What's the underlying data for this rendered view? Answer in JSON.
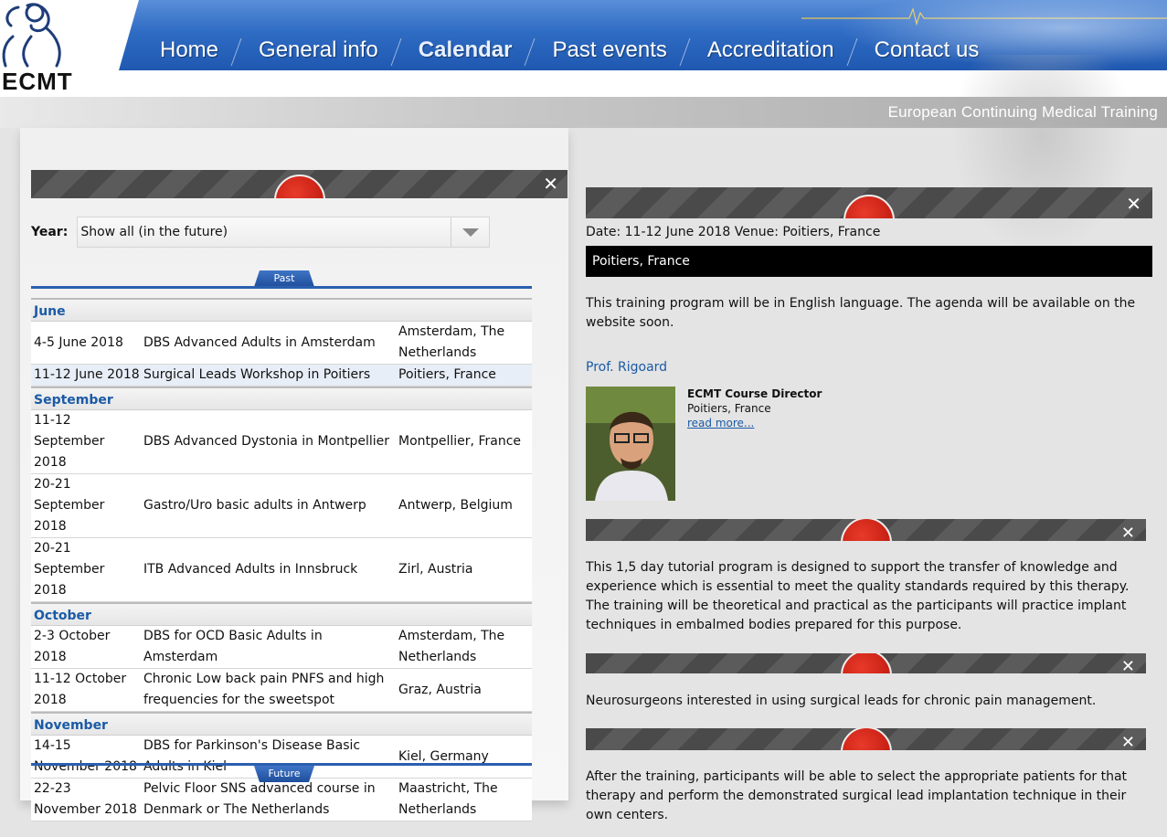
{
  "logo": {
    "text": "ECMT"
  },
  "nav": {
    "items": [
      {
        "label": "Home"
      },
      {
        "label": "General info"
      },
      {
        "label": "Calendar"
      },
      {
        "label": "Past events"
      },
      {
        "label": "Accreditation"
      },
      {
        "label": "Contact us"
      }
    ],
    "active": "Calendar"
  },
  "tagline": "European Continuing Medical Training",
  "filter": {
    "year_label": "Year:",
    "year_value": "Show all (in the future)"
  },
  "pager": {
    "past_label": "Past",
    "future_label": "Future"
  },
  "calendar": {
    "months": [
      {
        "name": "June",
        "events": [
          {
            "date": "4-5 June 2018",
            "title": "DBS Advanced Adults in Amsterdam",
            "location": "Amsterdam, The Netherlands"
          },
          {
            "date": "11-12 June 2018",
            "title": "Surgical Leads Workshop in Poitiers",
            "location": "Poitiers, France"
          }
        ]
      },
      {
        "name": "September",
        "events": [
          {
            "date": "11-12 September 2018",
            "title": "DBS Advanced Dystonia in Montpellier",
            "location": "Montpellier, France"
          },
          {
            "date": "20-21 September 2018",
            "title": "Gastro/Uro basic adults in Antwerp",
            "location": "Antwerp, Belgium"
          },
          {
            "date": "20-21 September 2018",
            "title": "ITB Advanced Adults in Innsbruck",
            "location": "Zirl, Austria"
          }
        ]
      },
      {
        "name": "October",
        "events": [
          {
            "date": "2-3 October 2018",
            "title": "DBS for OCD Basic Adults in Amsterdam",
            "location": "Amsterdam, The Netherlands"
          },
          {
            "date": "11-12 October 2018",
            "title": "Chronic Low back pain PNFS and high frequencies for the sweetspot",
            "location": "Graz, Austria"
          }
        ]
      },
      {
        "name": "November",
        "events": [
          {
            "date": "14-15 November 2018",
            "title": "DBS for Parkinson's Disease Basic Adults in Kiel",
            "location": "Kiel, Germany"
          },
          {
            "date": "22-23 November 2018",
            "title": "Pelvic Floor SNS advanced course in Denmark or The Netherlands",
            "location": "Maastricht, The Netherlands"
          }
        ]
      }
    ]
  },
  "detail": {
    "date_venue": "Date: 11-12 June 2018   Venue: Poitiers, France",
    "place_bar": "Poitiers, France",
    "intro": "This training program will be in English language. The agenda will be available on the website soon.",
    "director": {
      "name": "Prof. Rigoard",
      "title": "ECMT Course Director",
      "location": "Poitiers, France",
      "read_more": "read more..."
    },
    "description": "This 1,5 day tutorial program is designed to support the transfer of knowledge and experience which is essential to meet the quality standards required by this therapy. The training will be theoretical and practical as the participants will practice implant techniques in embalmed bodies prepared for this purpose.",
    "audience": "Neurosurgeons interested in using surgical leads for chronic pain management.",
    "outcome": "After the training, participants will be able to select the appropriate patients for that therapy and perform the demonstrated surgical lead implantation technique in their own centers."
  },
  "close_symbol": "✕"
}
